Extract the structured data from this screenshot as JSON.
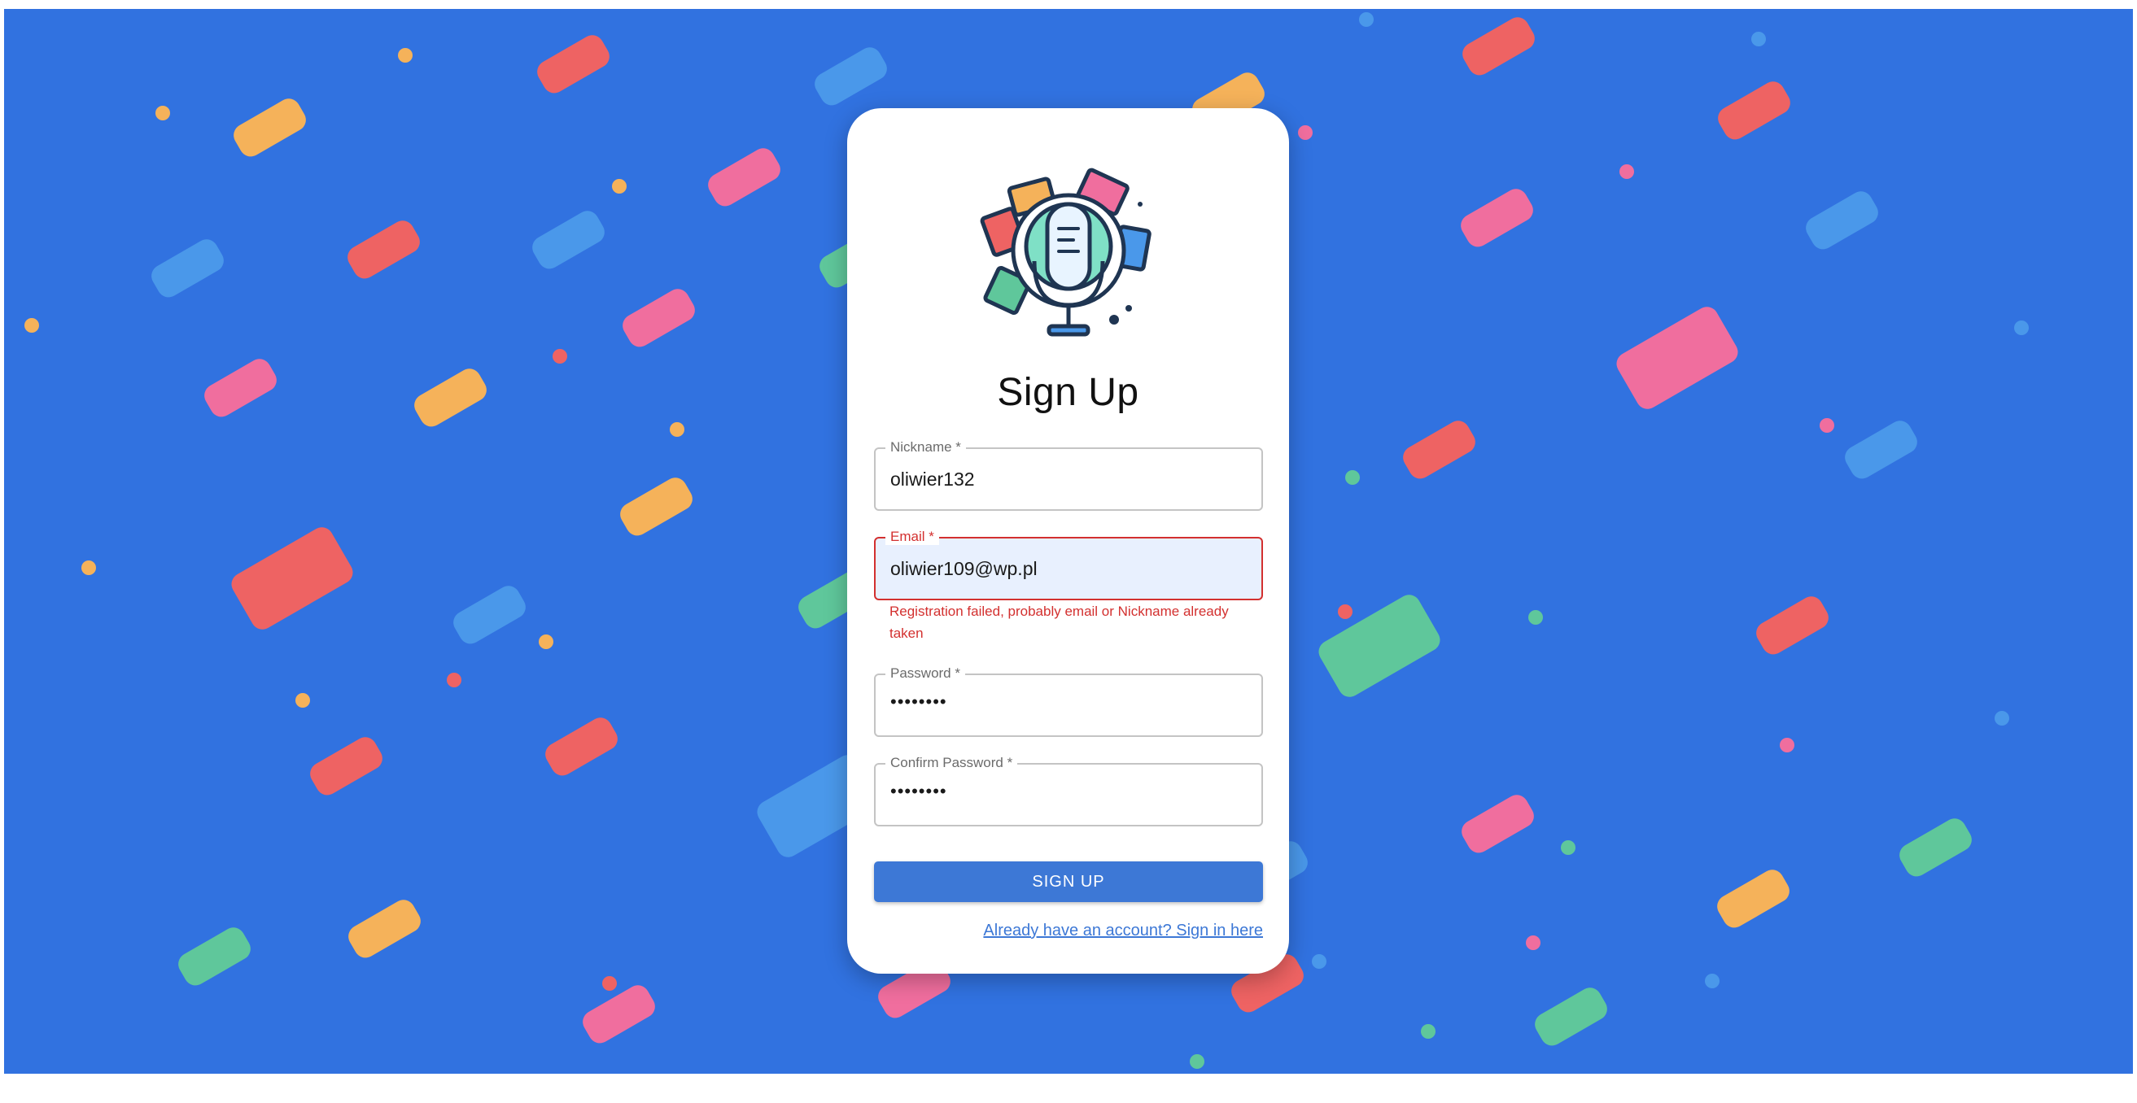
{
  "form": {
    "title": "Sign Up",
    "nickname": {
      "label": "Nickname *",
      "value": "oliwier132"
    },
    "email": {
      "label": "Email *",
      "value": "oliwier109@wp.pl",
      "error": "Registration failed, probably email or Nickname already taken"
    },
    "password": {
      "label": "Password *",
      "value": "••••••••"
    },
    "confirm_password": {
      "label": "Confirm Password *",
      "value": "••••••••"
    },
    "submit_label": "SIGN UP",
    "signin_link": "Already have an account? Sign in here"
  },
  "logo": {
    "icon": "microphone-logo-icon"
  },
  "colors": {
    "background": "#3172e0",
    "accent": "#3d78d6",
    "error": "#d3302f",
    "confetti": [
      "#ee6363",
      "#f5b25a",
      "#f06e9e",
      "#5fc79b",
      "#4a98ea"
    ]
  }
}
